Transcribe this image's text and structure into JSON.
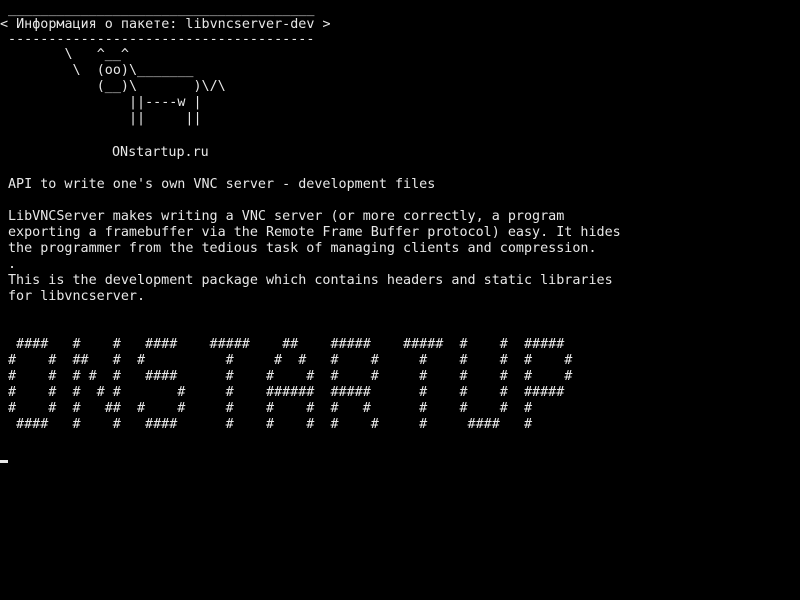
{
  "terminal": {
    "cowsay_bubble": [
      " ______________________________________",
      "< Информация о пакете: libvncserver-dev >",
      " --------------------------------------"
    ],
    "cow_art": [
      "        \\   ^__^",
      "         \\  (oo)\\_______",
      "            (__)\\       )\\/\\",
      "                ||----w |",
      "                ||     ||"
    ],
    "site": "ONstartup.ru",
    "package_summary": "API to write one's own VNC server - development files",
    "description": [
      "LibVNCServer makes writing a VNC server (or more correctly, a program",
      "exporting a framebuffer via the Remote Frame Buffer protocol) easy. It hides",
      "the programmer from the tedious task of managing clients and compression.",
      ".",
      "This is the development package which contains headers and static libraries",
      "for libvncserver."
    ],
    "banner": [
      " ####   #    #   ####    #####    ##    #####    #####  #    #  #####",
      "#    #  ##   #  #          #     #  #   #    #     #    #    #  #    #",
      "#    #  # #  #   ####      #    #    #  #    #     #    #    #  #    #",
      "#    #  #  # #       #     #    ######  #####      #    #    #  #####",
      "#    #  #   ##  #    #     #    #    #  #   #      #    #    #  #",
      " ####   #    #   ####      #    #    #  #    #     #     ####   #"
    ],
    "cursor_char": "_",
    "colors": {
      "background": "#000000",
      "foreground": "#e8e8e8"
    }
  }
}
